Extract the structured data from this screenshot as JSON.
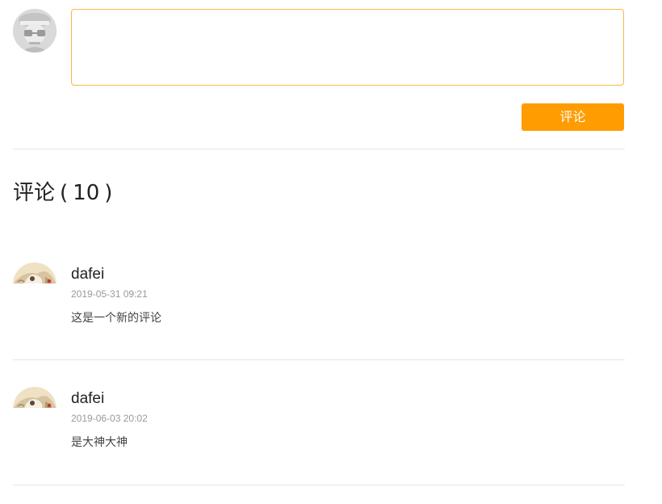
{
  "compose": {
    "avatar_icon": "default-user-avatar-icon",
    "textarea_value": "",
    "textarea_placeholder": "",
    "submit_label": "评论"
  },
  "comments_section": {
    "heading_label": "评论",
    "open_paren": "(",
    "count": "10",
    "close_paren": ")"
  },
  "comments": [
    {
      "author": "dafei",
      "time": "2019-05-31 09:21",
      "text": "这是一个新的评论",
      "avatar_icon": "user-avatar-icon"
    },
    {
      "author": "dafei",
      "time": "2019-06-03 20:02",
      "text": "是大神大神",
      "avatar_icon": "user-avatar-icon"
    }
  ],
  "colors": {
    "accent": "#ff9c00",
    "input_border": "#f5b949",
    "divider": "#e6e6e6",
    "muted_text": "#999999"
  }
}
